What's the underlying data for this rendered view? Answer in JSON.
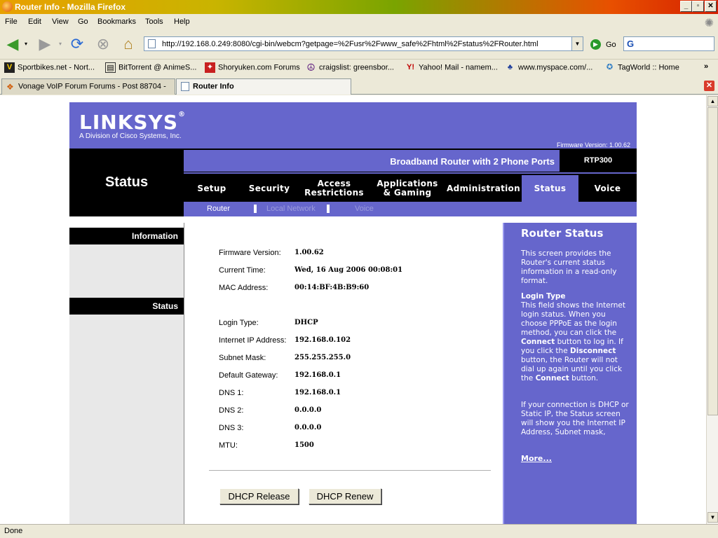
{
  "window": {
    "title": "Router Info - Mozilla Firefox"
  },
  "menu": [
    "File",
    "Edit",
    "View",
    "Go",
    "Bookmarks",
    "Tools",
    "Help"
  ],
  "navbar": {
    "url": "http://192.168.0.249:8080/cgi-bin/webcm?getpage=%2Fusr%2Fwww_safe%2Fhtml%2Fstatus%2FRouter.html",
    "go_label": "Go",
    "search_placeholder": "G"
  },
  "bookmarks": [
    {
      "label": "Sportbikes.net - Nort...",
      "icon": "sportbikes-icon"
    },
    {
      "label": "BitTorrent @ AnimeS...",
      "icon": "bittorrent-icon"
    },
    {
      "label": "Shoryuken.com Forums",
      "icon": "shoryuken-icon"
    },
    {
      "label": "craigslist: greensbor...",
      "icon": "peace-icon"
    },
    {
      "label": "Yahoo! Mail - namem...",
      "icon": "yahoo-icon"
    },
    {
      "label": "www.myspace.com/...",
      "icon": "myspace-icon"
    },
    {
      "label": "TagWorld :: Home",
      "icon": "tagworld-icon"
    }
  ],
  "tabs": [
    {
      "label": "Vonage VoIP Forum Forums - Post 88704 -",
      "active": false
    },
    {
      "label": "Router Info",
      "active": true
    }
  ],
  "linksys": {
    "logo": "LINKSYS",
    "logo_mark": "®",
    "subtitle": "A Division of Cisco Systems, Inc.",
    "firmware_label": "Firmware Version: 1.00.62",
    "page_title": "Status",
    "product_name": "Broadband Router with 2 Phone Ports",
    "model": "RTP300",
    "menu": [
      {
        "line1": "Setup",
        "line2": ""
      },
      {
        "line1": "Security",
        "line2": ""
      },
      {
        "line1": "Access",
        "line2": "Restrictions"
      },
      {
        "line1": "Applications",
        "line2": "& Gaming"
      },
      {
        "line1": "Administration",
        "line2": ""
      },
      {
        "line1": "Status",
        "line2": ""
      },
      {
        "line1": "Voice",
        "line2": ""
      }
    ],
    "submenu": [
      "Router",
      "Local Network",
      "Voice"
    ],
    "side_headers": [
      "Information",
      "Status"
    ],
    "fields": [
      {
        "label": "Firmware Version:",
        "value": "1.00.62"
      },
      {
        "label": "Current Time:",
        "value": "Wed, 16 Aug 2006 00:08:01"
      },
      {
        "label": "MAC Address:",
        "value": "00:14:BF:4B:B9:60"
      },
      {
        "label": "Login Type:",
        "value": "DHCP"
      },
      {
        "label": "Internet IP Address:",
        "value": "192.168.0.102"
      },
      {
        "label": "Subnet Mask:",
        "value": "255.255.255.0"
      },
      {
        "label": "Default Gateway:",
        "value": "192.168.0.1"
      },
      {
        "label": "DNS 1:",
        "value": "192.168.0.1"
      },
      {
        "label": "DNS 2:",
        "value": "0.0.0.0"
      },
      {
        "label": "DNS 3:",
        "value": "0.0.0.0"
      },
      {
        "label": "MTU:",
        "value": "1500"
      }
    ],
    "buttons": {
      "release": "DHCP Release",
      "renew": "DHCP Renew"
    },
    "help": {
      "title": "Router Status",
      "intro": "This screen provides the Router's current status information in a read-only format.",
      "login_heading": "Login Type",
      "login_p1": "This field shows the Internet login status. When you choose PPPoE as the login method, you can click the",
      "connect": "Connect",
      "login_p2": "button to log in. If you click the",
      "disconnect": "Disconnect",
      "login_p3": "button, the Router will not dial up again until you click the",
      "login_p4": "button.",
      "dhcp_note": "If your connection is DHCP or Static IP, the Status screen will show you the Internet IP Address, Subnet mask,",
      "more": "More..."
    }
  },
  "status": "Done"
}
